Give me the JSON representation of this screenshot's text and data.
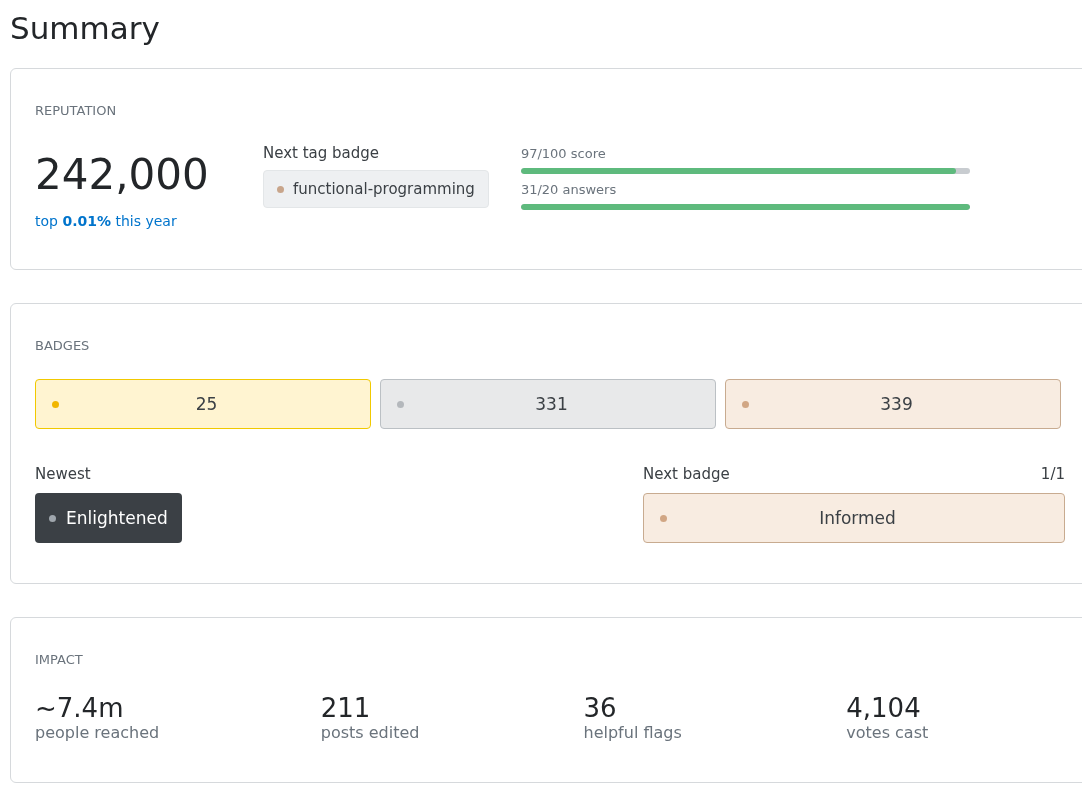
{
  "title": "Summary",
  "reputation": {
    "heading": "REPUTATION",
    "value": "242,000",
    "rank": "top **0.01%** this year",
    "next_tag_label": "Next tag badge",
    "next_tag": {
      "name": "functional-programming",
      "color": "#c8a58b"
    },
    "progress": [
      {
        "label": "97/100 score",
        "level": 0.97
      },
      {
        "label": "31/20 answers",
        "level": 1
      }
    ]
  },
  "badges": {
    "heading": "BADGES",
    "counts": [
      {
        "count": "25",
        "color": "#f1b600",
        "kind": "gold"
      },
      {
        "count": "331",
        "color": "#b4b8bc",
        "kind": "silver"
      },
      {
        "count": "339",
        "color": "#d1a684",
        "kind": "bronze"
      }
    ],
    "newest_label": "Newest",
    "newest": {
      "name": "Enlightened",
      "color": "#9fa6ad"
    },
    "next_label": "Next badge",
    "next_count": "1/1",
    "next": {
      "name": "Informed",
      "color": "#d1a684",
      "kind": "bronze"
    }
  },
  "impact": {
    "heading": "IMPACT",
    "stats": [
      {
        "value": "~7.4m",
        "label": "people reached"
      },
      {
        "value": "211",
        "label": "posts edited"
      },
      {
        "value": "36",
        "label": "helpful flags"
      },
      {
        "value": "4,104",
        "label": "votes cast"
      }
    ]
  }
}
